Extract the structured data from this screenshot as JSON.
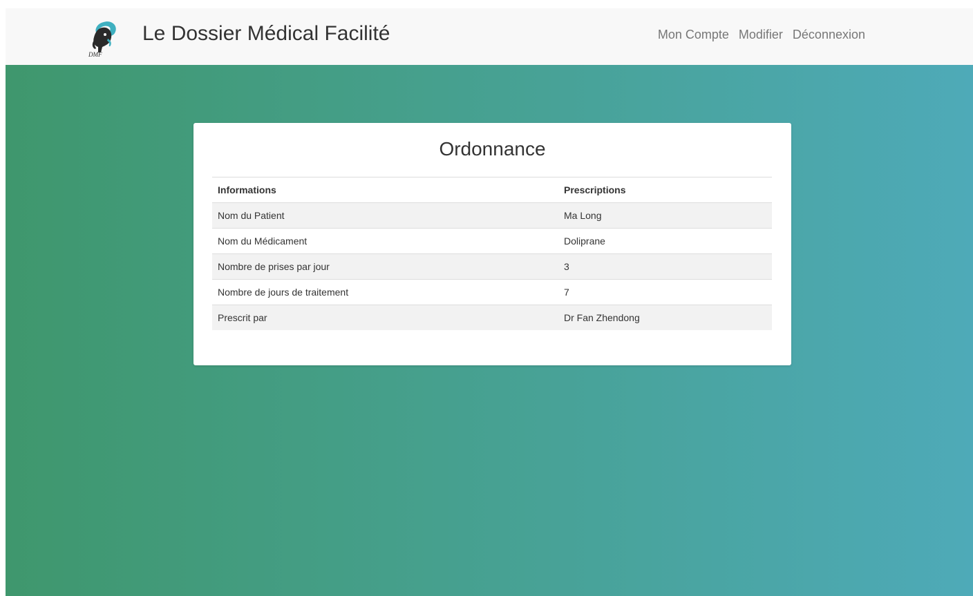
{
  "header": {
    "logo_text": "DMF",
    "brand": "Le Dossier Médical Facilité",
    "nav": [
      {
        "label": "Mon Compte"
      },
      {
        "label": "Modifier"
      },
      {
        "label": "Déconnexion"
      }
    ]
  },
  "colors": {
    "navbar_bg": "#f8f8f8",
    "gradient_start": "#3f976d",
    "gradient_end": "#4eaab8",
    "logo_teal": "#3fb0c0"
  },
  "card": {
    "title": "Ordonnance",
    "table": {
      "headers": [
        "Informations",
        "Prescriptions"
      ],
      "rows": [
        [
          "Nom du Patient",
          "Ma Long"
        ],
        [
          "Nom du Médicament",
          "Doliprane"
        ],
        [
          "Nombre de prises par jour",
          "3"
        ],
        [
          "Nombre de jours de traitement",
          "7"
        ],
        [
          "Prescrit par",
          "Dr Fan Zhendong"
        ]
      ]
    }
  }
}
